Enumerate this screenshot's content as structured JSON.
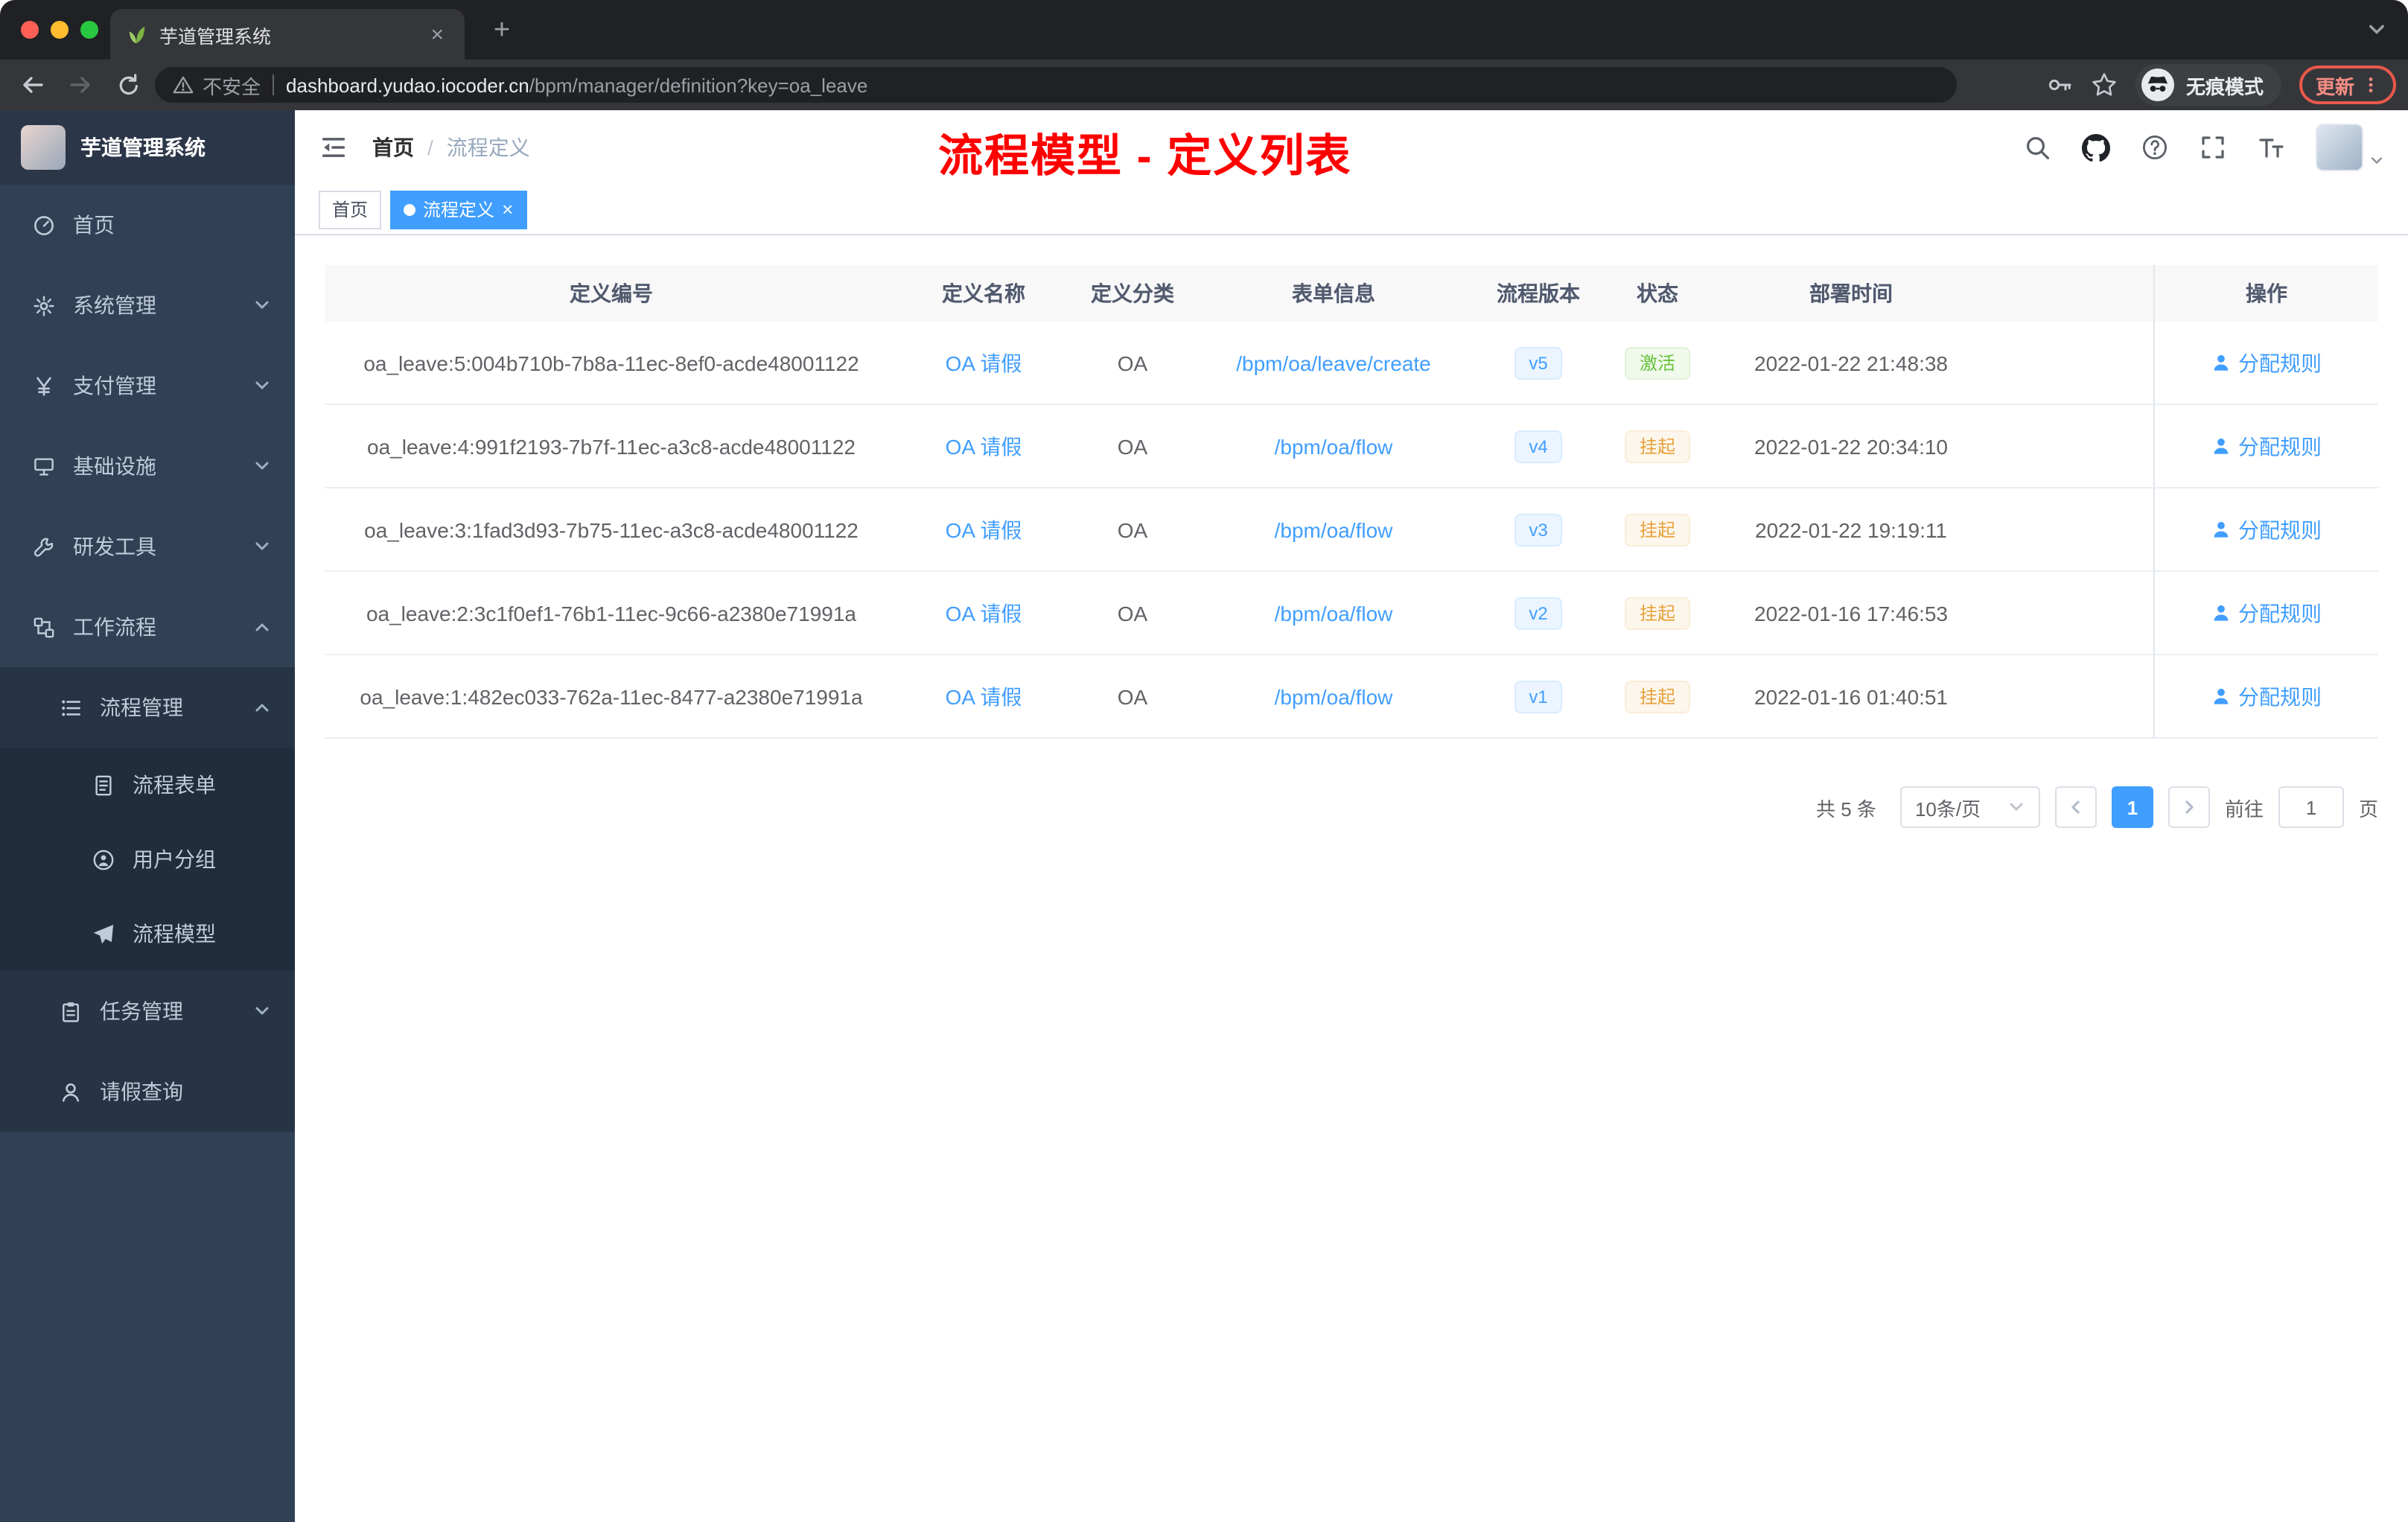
{
  "colors": {
    "accent": "#409eff",
    "status_active": "#67c23a",
    "status_suspended": "#e6a23c",
    "annotation_red": "#ff0000",
    "sidebar_bg": "#304156",
    "tag_active_bg": "#409eff"
  },
  "icons": [
    "back-icon",
    "forward-icon",
    "reload-icon",
    "warning-icon",
    "key-icon",
    "bookmark-star-icon",
    "incognito-icon",
    "kebab-menu-icon",
    "leaf-favicon",
    "search-icon",
    "github-icon",
    "help-icon",
    "fullscreen-icon",
    "font-size-icon",
    "hamburger-fold-icon",
    "user-icon",
    "caret-down-icon",
    "close-icon",
    "plus-icon"
  ],
  "browser": {
    "tab_title": "芋道管理系统",
    "security_label": "不安全",
    "url_host": "dashboard.yudao.iocoder.cn",
    "url_path": "/bpm/manager/definition?key=oa_leave",
    "incognito_label": "无痕模式",
    "update_label": "更新"
  },
  "sidebar": {
    "logo_title": "芋道管理系统",
    "menu": [
      "首页",
      "系统管理",
      "支付管理",
      "基础设施",
      "研发工具",
      "工作流程",
      "流程管理",
      "流程表单",
      "用户分组",
      "流程模型",
      "任务管理",
      "请假查询"
    ]
  },
  "navbar": {
    "breadcrumb_home": "首页",
    "breadcrumb_current": "流程定义",
    "annotation": "流程模型 - 定义列表"
  },
  "tags": {
    "home": "首页",
    "current": "流程定义"
  },
  "table": {
    "headers": [
      "定义编号",
      "定义名称",
      "定义分类",
      "表单信息",
      "流程版本",
      "状态",
      "部署时间",
      "操作"
    ],
    "rows": [
      {
        "id": "oa_leave:5:004b710b-7b8a-11ec-8ef0-acde48001122",
        "name": "OA 请假",
        "category": "OA",
        "form": "/bpm/oa/leave/create",
        "version": "v5",
        "status": "激活",
        "time": "2022-01-22 21:48:38",
        "action": "分配规则"
      },
      {
        "id": "oa_leave:4:991f2193-7b7f-11ec-a3c8-acde48001122",
        "name": "OA 请假",
        "category": "OA",
        "form": "/bpm/oa/flow",
        "version": "v4",
        "status": "挂起",
        "time": "2022-01-22 20:34:10",
        "action": "分配规则"
      },
      {
        "id": "oa_leave:3:1fad3d93-7b75-11ec-a3c8-acde48001122",
        "name": "OA 请假",
        "category": "OA",
        "form": "/bpm/oa/flow",
        "version": "v3",
        "status": "挂起",
        "time": "2022-01-22 19:19:11",
        "action": "分配规则"
      },
      {
        "id": "oa_leave:2:3c1f0ef1-76b1-11ec-9c66-a2380e71991a",
        "name": "OA 请假",
        "category": "OA",
        "form": "/bpm/oa/flow",
        "version": "v2",
        "status": "挂起",
        "time": "2022-01-16 17:46:53",
        "action": "分配规则"
      },
      {
        "id": "oa_leave:1:482ec033-762a-11ec-8477-a2380e71991a",
        "name": "OA 请假",
        "category": "OA",
        "form": "/bpm/oa/flow",
        "version": "v1",
        "status": "挂起",
        "time": "2022-01-16 01:40:51",
        "action": "分配规则"
      }
    ]
  },
  "pagination": {
    "total": "共 5 条",
    "page_size": "10条/页",
    "current": "1",
    "goto_label": "前往",
    "goto_value": "1",
    "page_unit": "页"
  }
}
